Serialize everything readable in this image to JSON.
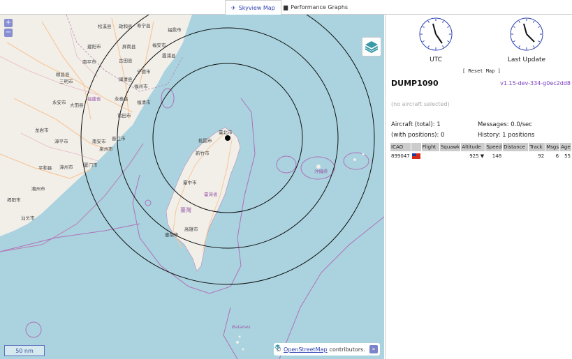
{
  "tabs": [
    {
      "label": "Skyview Map",
      "icon": "plane-icon"
    },
    {
      "label": "Performance Graphs",
      "icon": "chart-icon"
    }
  ],
  "map": {
    "zoom_in": "+",
    "zoom_out": "−",
    "scale_label": "50 nm",
    "attribution_prefix": "©",
    "attribution_link": "OpenStreetMap",
    "attribution_suffix": "contributors.",
    "attribution_toggle": "»",
    "labels": [
      {
        "text": "松溪县"
      },
      {
        "text": "政和县"
      },
      {
        "text": "寿宁县"
      },
      {
        "text": "福鼎市"
      },
      {
        "text": "建阳市"
      },
      {
        "text": "屏南县"
      },
      {
        "text": "福安市"
      },
      {
        "text": "霞浦县"
      },
      {
        "text": "南平市"
      },
      {
        "text": "古田县"
      },
      {
        "text": "宁德市"
      },
      {
        "text": "顺昌县"
      },
      {
        "text": "闽清县"
      },
      {
        "text": "福州市"
      },
      {
        "text": "永泰县"
      },
      {
        "text": "福清市"
      },
      {
        "text": "福建省"
      },
      {
        "text": "莆田市"
      },
      {
        "text": "泉州市"
      },
      {
        "text": "晋江市"
      },
      {
        "text": "厦门市"
      },
      {
        "text": "漳州市"
      },
      {
        "text": "龙岩市"
      },
      {
        "text": "平和县"
      },
      {
        "text": "揭阳市"
      },
      {
        "text": "汕头市"
      },
      {
        "text": "潮州市"
      },
      {
        "text": "三明市"
      },
      {
        "text": "大田县"
      },
      {
        "text": "永安市"
      },
      {
        "text": "漳平市"
      },
      {
        "text": "南安市"
      },
      {
        "text": "臺北市"
      },
      {
        "text": "桃園市"
      },
      {
        "text": "新竹市"
      },
      {
        "text": "臺中市"
      },
      {
        "text": "臺灣省"
      },
      {
        "text": "臺灣"
      },
      {
        "text": "高雄市"
      },
      {
        "text": "臺南市"
      },
      {
        "text": "沖繩県"
      },
      {
        "text": "Batanes"
      }
    ]
  },
  "sidebar": {
    "clock_utc_label": "UTC",
    "clock_update_label": "Last Update",
    "reset_map": "[ Reset Map ]",
    "title": "DUMP1090",
    "version": "v1.15-dev-334-g0ec2dd8",
    "no_aircraft": "(no aircraft selected)",
    "aircraft_total": "Aircraft (total): 1",
    "with_positions": "(with positions): 0",
    "messages": "Messages: 0.0/sec",
    "history": "History: 1 positions",
    "table": {
      "headers": [
        "ICAO",
        "",
        "Flight",
        "Squawk",
        "Altitude",
        "Speed",
        "Distance",
        "Track",
        "Msgs",
        "Age"
      ],
      "rows": [
        {
          "icao": "899047",
          "flag": "taiwan-flag",
          "flight": "",
          "squawk": "",
          "altitude": "925",
          "alt_trend": "▼",
          "speed": "148",
          "distance": "",
          "track": "92",
          "msgs": "6",
          "age": "55"
        }
      ]
    }
  },
  "colors": {
    "accent": "#2a3fb0",
    "version": "#7a40c0",
    "sea": "#aad3df",
    "land": "#f2efe9"
  }
}
